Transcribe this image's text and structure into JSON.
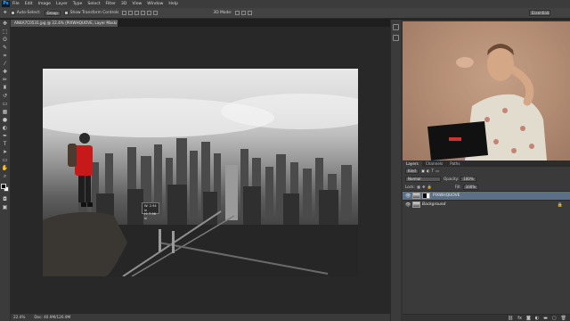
{
  "menubar": {
    "logo": "Ps",
    "items": [
      "File",
      "Edit",
      "Image",
      "Layer",
      "Type",
      "Select",
      "Filter",
      "3D",
      "View",
      "Window",
      "Help"
    ]
  },
  "options": {
    "auto_select_label": "Auto-Select:",
    "auto_select_value": "Group",
    "show_transform_label": "Show Transform Controls",
    "mode_3d_label": "3D Mode:",
    "workspace_value": "Essentials"
  },
  "document": {
    "tab_title": "AN4A7C0531.jpg @ 22.4% (PIXWHQUOVE, Layer Mask/8) *",
    "tooltip_w": "W: 2.94 in",
    "tooltip_h": "H: 7.96 in"
  },
  "status": {
    "zoom": "22.4%",
    "doc_size": "Doc: 40.9M/126.9M"
  },
  "layers_panel": {
    "tabs": [
      "Layers",
      "Channels",
      "Paths"
    ],
    "kind_label": "Kind",
    "blend_mode": "Normal",
    "opacity_label": "Opacity:",
    "opacity_value": "100%",
    "lock_label": "Lock:",
    "fill_label": "Fill:",
    "fill_value": "100%",
    "layers": [
      {
        "name": "PIXWHQUOVE",
        "selected": true
      },
      {
        "name": "Background",
        "selected": false
      }
    ]
  },
  "colors": {
    "selection": "#5b6f86",
    "jacket": "#c61a1a",
    "accent": "#31a8ff"
  }
}
